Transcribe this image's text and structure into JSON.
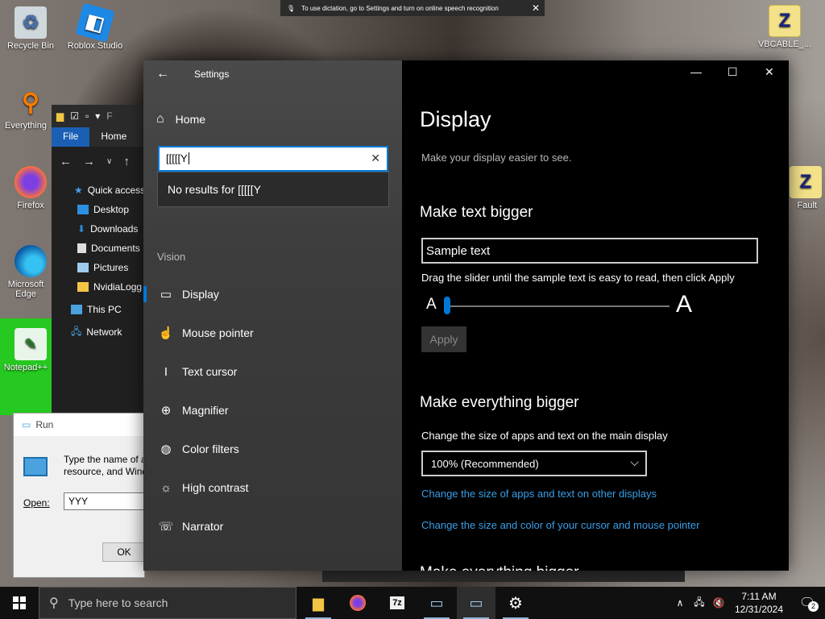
{
  "dictation": {
    "text": "To use dictation, go to Settings and turn on online speech recognition",
    "close": "✕"
  },
  "desktop_icons": [
    {
      "label": "Recycle Bin",
      "icon": "recycle-bin-icon"
    },
    {
      "label": "Roblox Studio",
      "icon": "roblox-studio-icon"
    },
    {
      "label": "Everything",
      "icon": "everything-search-icon"
    },
    {
      "label": "Firefox",
      "icon": "firefox-icon"
    },
    {
      "label": "Microsoft Edge",
      "icon": "edge-icon"
    },
    {
      "label": "Notepad++",
      "icon": "notepad-plus-icon"
    },
    {
      "label": "VBCABLE_...",
      "icon": "zip-folder-icon"
    },
    {
      "label": "Fault",
      "icon": "zip-icon"
    }
  ],
  "explorer": {
    "title_initial": "F",
    "tabs": [
      "File",
      "Home"
    ],
    "tree": [
      "Quick access",
      "Desktop",
      "Downloads",
      "Documents",
      "Pictures",
      "NvidiaLogg",
      "This PC",
      "Network"
    ]
  },
  "run": {
    "title": "Run",
    "desc_line1": "Type the name of a",
    "desc_line2": "resource, and Wind",
    "open_label": "Open:",
    "open_value": "YYY",
    "ok": "OK"
  },
  "settings": {
    "app_title": "Settings",
    "home": "Home",
    "search_value": "[[[[[Y",
    "no_results": "No results for [[[[[Y",
    "section": "Vision",
    "nav": [
      {
        "label": "Display",
        "icon": "monitor-icon",
        "glyph": "▭",
        "active": true
      },
      {
        "label": "Mouse pointer",
        "icon": "mouse-pointer-icon",
        "glyph": "☝",
        "active": false
      },
      {
        "label": "Text cursor",
        "icon": "text-cursor-icon",
        "glyph": "I",
        "active": false
      },
      {
        "label": "Magnifier",
        "icon": "magnifier-icon",
        "glyph": "⊕",
        "active": false
      },
      {
        "label": "Color filters",
        "icon": "palette-icon",
        "glyph": "◍",
        "active": false
      },
      {
        "label": "High contrast",
        "icon": "contrast-icon",
        "glyph": "☼",
        "active": false
      },
      {
        "label": "Narrator",
        "icon": "narrator-icon",
        "glyph": "☏",
        "active": false
      }
    ],
    "page_title": "Display",
    "page_sub": "Make your display easier to see.",
    "h_text_bigger": "Make text bigger",
    "sample_text": "Sample text",
    "slider_hint": "Drag the slider until the sample text is easy to read, then click Apply",
    "small_a": "A",
    "big_a": "A",
    "text_scale_percent": 0,
    "apply": "Apply",
    "h_everything_bigger": "Make everything bigger",
    "scale_label": "Change the size of apps and text on the main display",
    "scale_value": "100% (Recommended)",
    "link1": "Change the size of apps and text on other displays",
    "link2": "Change the size and color of your cursor and mouse pointer",
    "cutoff_heading": "Make everything bigger"
  },
  "taskbar": {
    "search_placeholder": "Type here to search",
    "apps": [
      "file-explorer-icon",
      "firefox-icon",
      "7zip-icon",
      "run-icon",
      "run-icon-2",
      "settings-gear-icon"
    ],
    "time": "7:11 AM",
    "date": "12/31/2024",
    "notifications": "2"
  }
}
